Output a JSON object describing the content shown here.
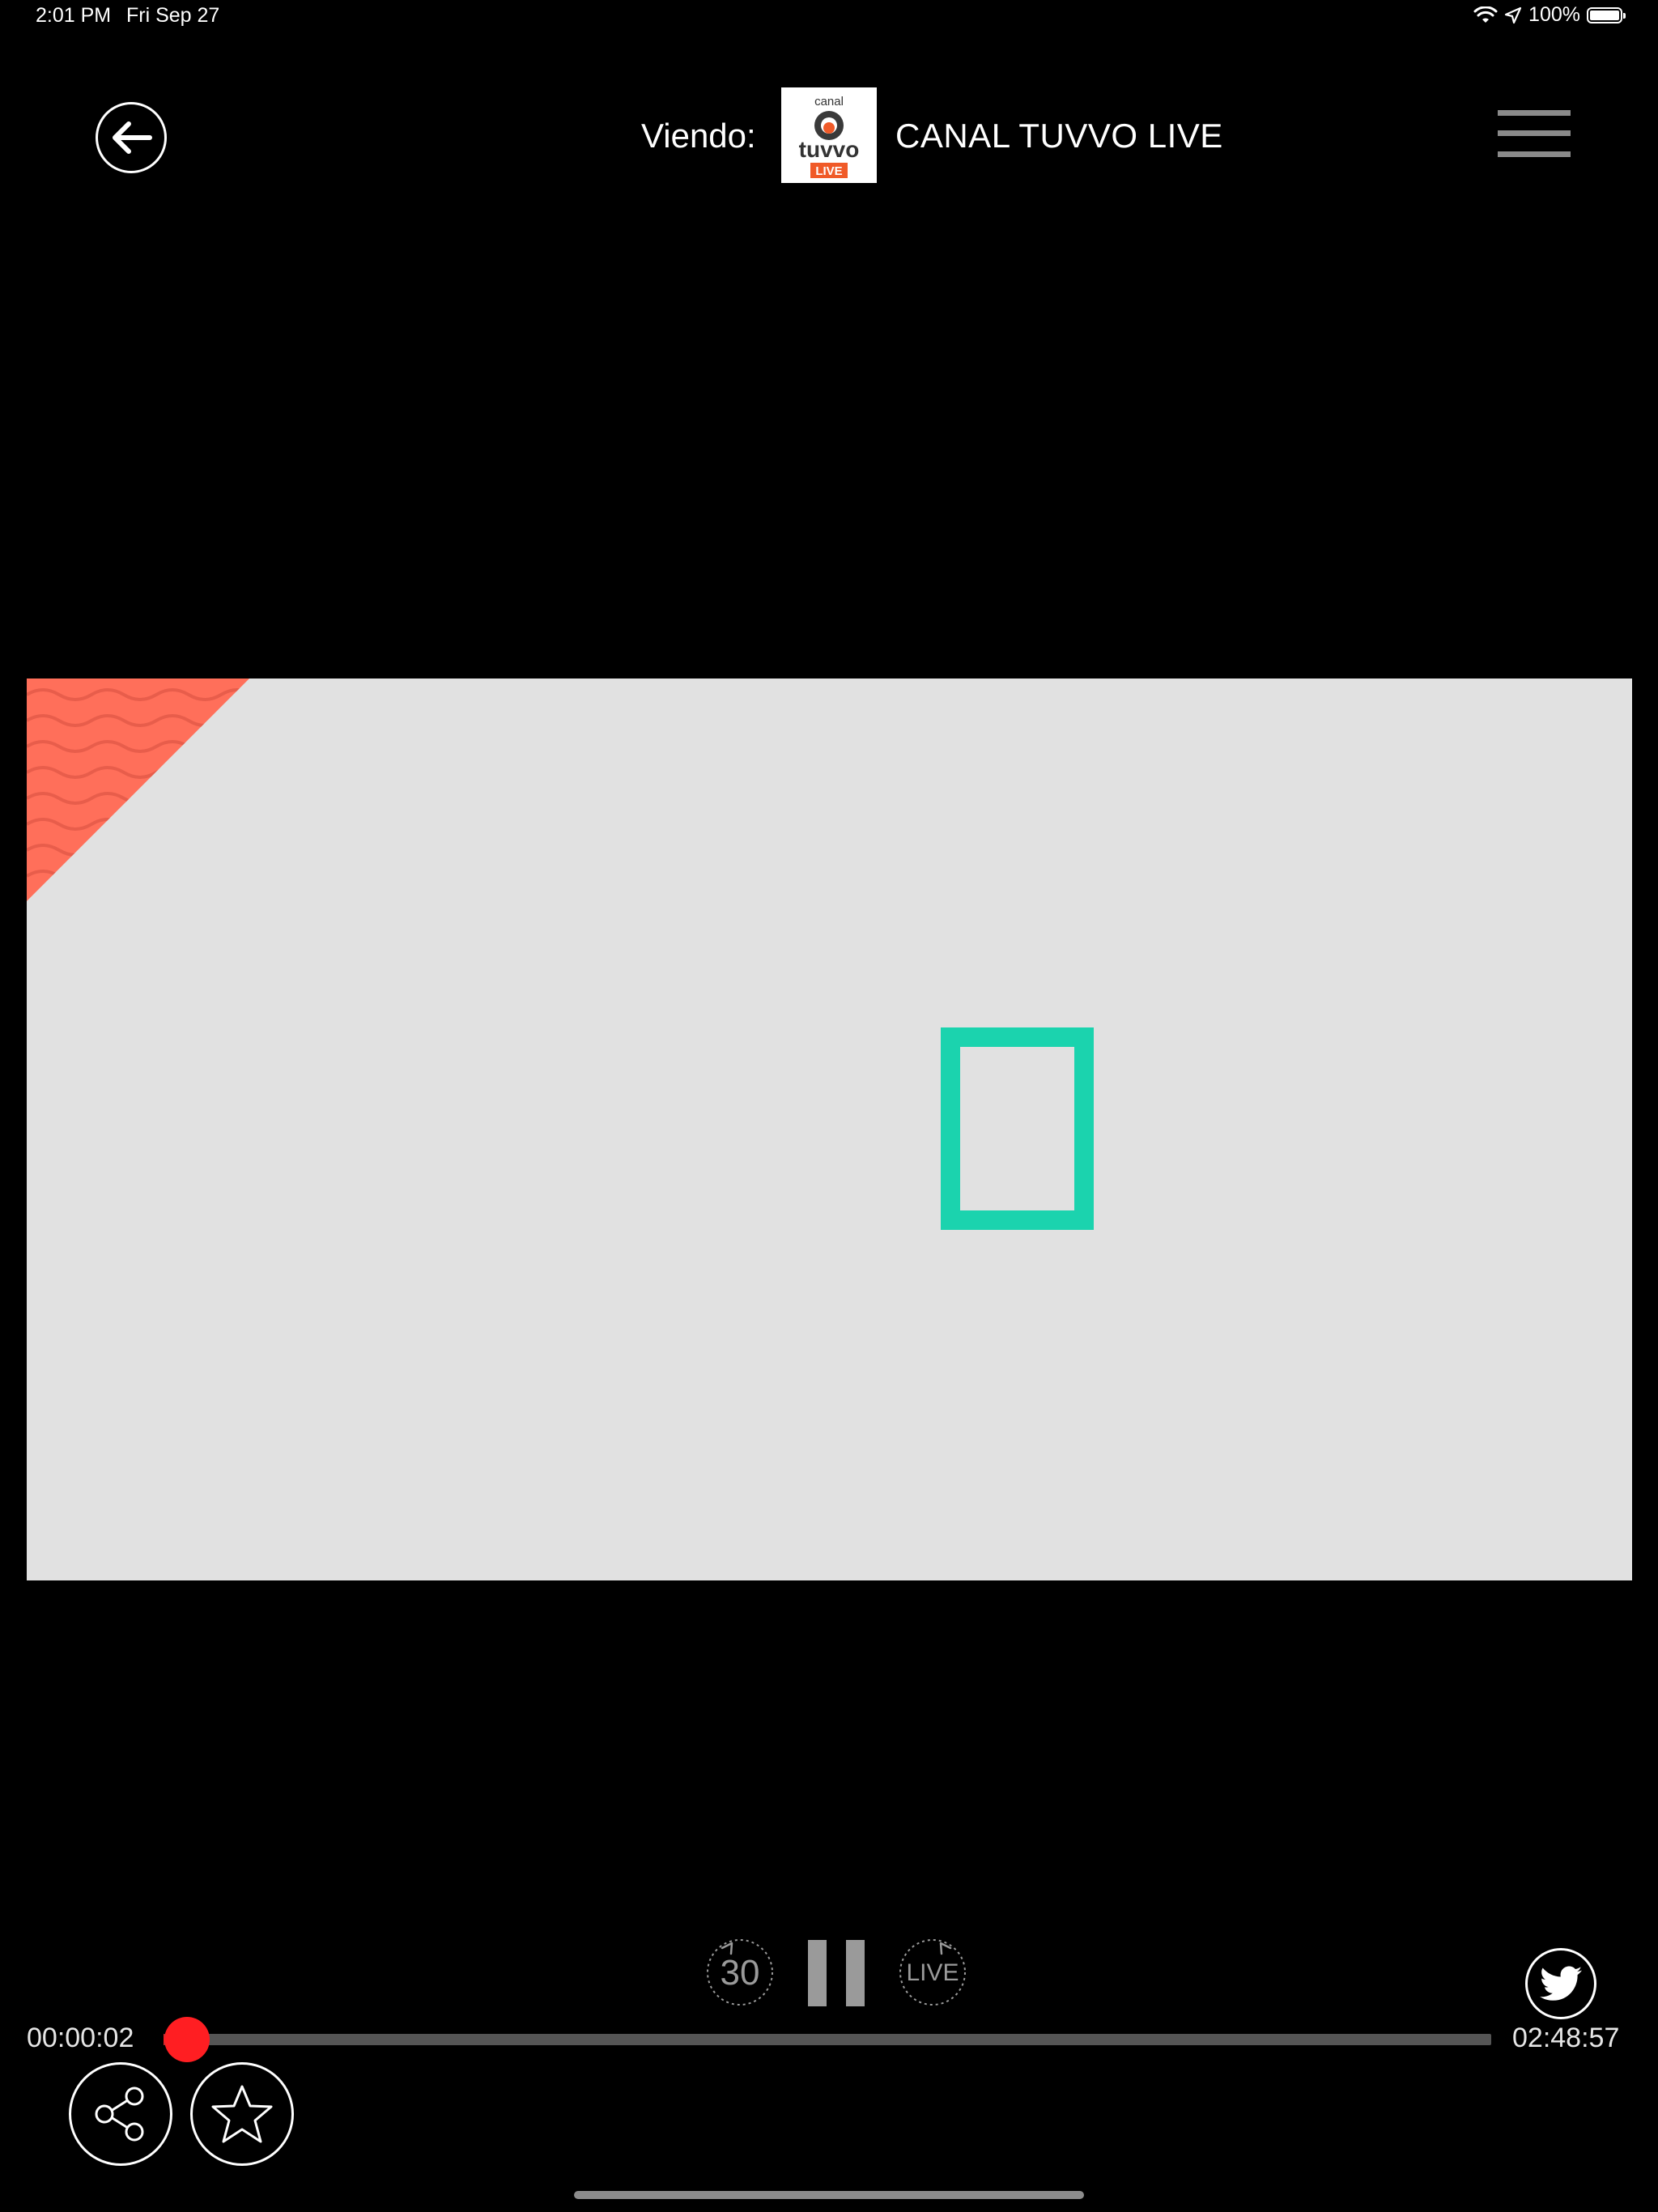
{
  "status_bar": {
    "time": "2:01 PM",
    "date": "Fri Sep 27",
    "battery_percent": "100%",
    "icons": [
      "wifi-icon",
      "location-arrow-icon",
      "battery-icon"
    ]
  },
  "header": {
    "back_icon": "arrow-left-icon",
    "viewing_label": "Viendo:",
    "channel_logo": {
      "top_text": "canal",
      "brand_text": "tuvvo",
      "badge_text": "LIVE"
    },
    "channel_name": "CANAL TUVVO LIVE",
    "menu_icon": "hamburger-menu-icon"
  },
  "player": {
    "background_color": "#e1e1e1",
    "corner_color": "#ff6f5a",
    "glyph_color": "#1bd3ae"
  },
  "controls": {
    "replay_label": "30",
    "live_label": "LIVE",
    "pause_icon": "pause-icon",
    "twitter_icon": "twitter-bird-icon"
  },
  "progress": {
    "elapsed": "00:00:02",
    "total": "02:48:57",
    "fraction": 0.0002,
    "fill_color": "#ff1e22"
  },
  "actions": {
    "share_icon": "share-icon",
    "favorite_icon": "star-icon"
  }
}
